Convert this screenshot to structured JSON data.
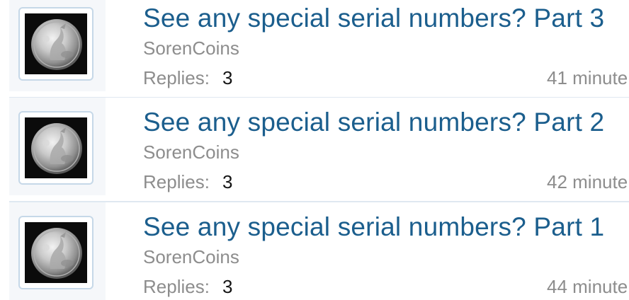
{
  "threads": [
    {
      "title": "See any special serial numbers? Part 3",
      "author": "SorenCoins",
      "replies_label": "Replies:",
      "replies_count": "3",
      "last_post_time": "41 minute"
    },
    {
      "title": "See any special serial numbers? Part 2",
      "author": "SorenCoins",
      "replies_label": "Replies:",
      "replies_count": "3",
      "last_post_time": "42 minute"
    },
    {
      "title": "See any special serial numbers? Part 1",
      "author": "SorenCoins",
      "replies_label": "Replies:",
      "replies_count": "3",
      "last_post_time": "44 minute"
    }
  ],
  "colors": {
    "title_link": "#1b5e8d",
    "muted_text": "#8d8d8d",
    "row_divider": "#dfe8f1",
    "avatar_border": "#c6d8e8",
    "avatar_cell_bg": "#f5f7fa"
  },
  "icons": {
    "avatar": "silver-coin-avatar"
  }
}
